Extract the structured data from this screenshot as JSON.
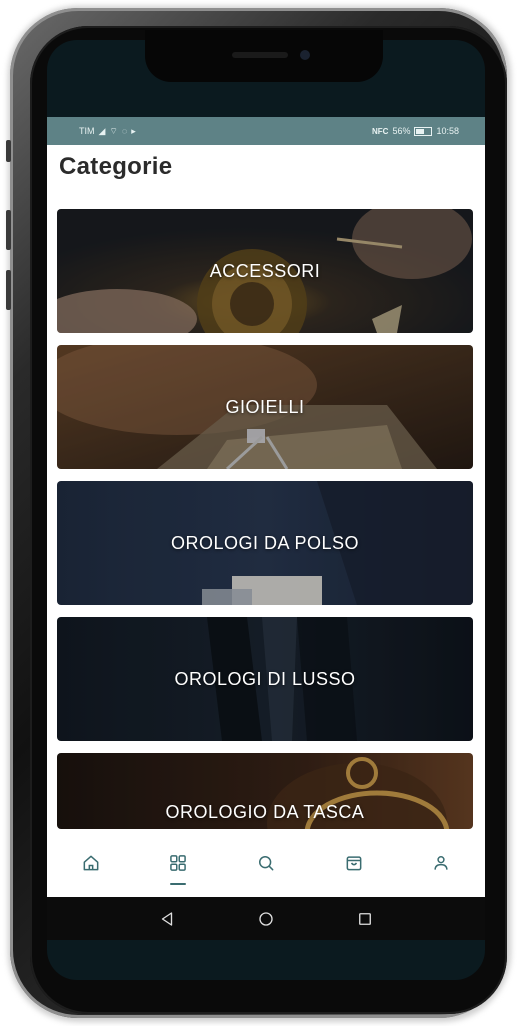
{
  "status_bar": {
    "carrier": "TIM",
    "left_icons": "signal wifi whatsapp play",
    "nfc_label": "NFC",
    "battery_percent": "56%",
    "time": "10:58"
  },
  "page": {
    "title": "Categorie"
  },
  "categories": [
    {
      "label": "ACCESSORI",
      "theme": "watch-movement"
    },
    {
      "label": "GIOIELLI",
      "theme": "jewelry-tools"
    },
    {
      "label": "OROLOGI DA POLSO",
      "theme": "suit-cuff"
    },
    {
      "label": "OROLOGI DI LUSSO",
      "theme": "suit-tie"
    },
    {
      "label": "OROLOGIO DA TASCA",
      "theme": "pocket-watch"
    }
  ],
  "bottom_nav": {
    "items": [
      {
        "icon": "home-icon",
        "active": false
      },
      {
        "icon": "grid-icon",
        "active": true
      },
      {
        "icon": "search-icon",
        "active": false
      },
      {
        "icon": "cart-icon",
        "active": false
      },
      {
        "icon": "profile-icon",
        "active": false
      }
    ]
  },
  "system_nav": {
    "items": [
      "back-icon",
      "home-circle-icon",
      "recents-icon"
    ]
  },
  "colors": {
    "status_bar": "#5e8286",
    "accent": "#3a6c70",
    "title": "#2b2b2b"
  }
}
